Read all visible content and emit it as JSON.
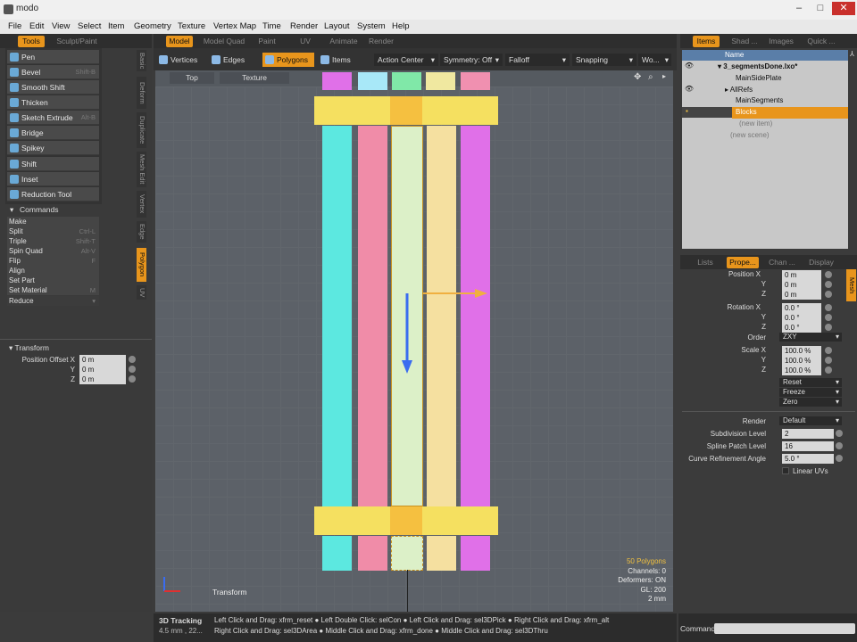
{
  "app": {
    "title": "modo"
  },
  "menu": [
    "File",
    "Edit",
    "View",
    "Select",
    "Item",
    "Geometry",
    "Texture",
    "Vertex Map",
    "Time",
    "Render",
    "Layout",
    "System",
    "Help"
  ],
  "left_tabs": {
    "tools": "Tools",
    "sculpt": "Sculpt/Paint"
  },
  "center_tabs": [
    "Model",
    "Model Quad",
    "Paint",
    "UV",
    "Animate",
    "Render"
  ],
  "right_tabs": [
    "Items",
    "Shad ...",
    "Images",
    "Quick ..."
  ],
  "tools": [
    {
      "label": "Pen",
      "shortcut": ""
    },
    {
      "label": "Bevel",
      "shortcut": "Shift-B"
    },
    {
      "label": "Smooth Shift",
      "shortcut": ""
    },
    {
      "label": "Thicken",
      "shortcut": ""
    },
    {
      "label": "Sketch Extrude",
      "shortcut": "Alt-B"
    },
    {
      "label": "Bridge",
      "shortcut": ""
    },
    {
      "label": "Spikey",
      "shortcut": ""
    },
    {
      "label": "Shift",
      "shortcut": ""
    },
    {
      "label": "Inset",
      "shortcut": ""
    },
    {
      "label": "Reduction Tool",
      "shortcut": ""
    }
  ],
  "commands_header": "Commands",
  "commands": [
    {
      "label": "Make",
      "shortcut": ""
    },
    {
      "label": "Split",
      "shortcut": "Ctrl-L"
    },
    {
      "label": "Triple",
      "shortcut": "Shift-T"
    },
    {
      "label": "Spin Quad",
      "shortcut": "Alt-V"
    },
    {
      "label": "Flip",
      "shortcut": "F"
    },
    {
      "label": "Align",
      "shortcut": ""
    },
    {
      "label": "Set Part",
      "shortcut": ""
    },
    {
      "label": "Set Material",
      "shortcut": "M"
    },
    {
      "label": "Reduce",
      "shortcut": ""
    }
  ],
  "side_vtabs": [
    "Basic",
    "Deform",
    "Duplicate",
    "Mesh Edit",
    "Vertex",
    "Edge",
    "Polygon",
    "UV"
  ],
  "transform_panel": {
    "header": "Transform",
    "pos_label": "Position Offset X",
    "y": "Y",
    "z": "Z",
    "x_val": "0 m",
    "y_val": "0 m",
    "z_val": "0 m"
  },
  "mode_bar": {
    "vertices": "Vertices",
    "edges": "Edges",
    "polygons": "Polygons",
    "items": "Items",
    "action_center": "Action Center",
    "symmetry": "Symmetry: Off",
    "falloff": "Falloff",
    "snapping": "Snapping",
    "wo": "Wo..."
  },
  "viewport": {
    "view": "Top",
    "shading": "Texture",
    "overlay": "Transform",
    "stats": [
      "50 Polygons",
      "Channels: 0",
      "Deformers: ON",
      "GL: 200",
      "2 mm"
    ]
  },
  "scene_tree": {
    "header": "Name",
    "scene": "3_segmentsDone.lxo*",
    "items": [
      "MainSidePlate",
      "AllRefs",
      "MainSegments",
      "Blocks",
      "(new item)",
      "(new scene)"
    ]
  },
  "props_tabs": [
    "Lists",
    "Prope...",
    "Chan ...",
    "Display"
  ],
  "props": {
    "position_label": "Position X",
    "px": "0 m",
    "py": "0 m",
    "pz": "0 m",
    "rotation_label": "Rotation X",
    "rx": "0.0 °",
    "ry": "0.0 °",
    "rz": "0.0 °",
    "order_label": "Order",
    "order": "ZXY",
    "scale_label": "Scale X",
    "sx": "100.0 %",
    "sy": "100.0 %",
    "sz": "100.0 %",
    "reset": "Reset",
    "freeze": "Freeze",
    "zero": "Zero",
    "render_label": "Render",
    "render": "Default",
    "subdiv_label": "Subdivision Level",
    "subdiv": "2",
    "spline_label": "Spline Patch Level",
    "spline": "16",
    "curve_label": "Curve Refinement Angle",
    "curve": "5.0 °",
    "linear_uvs": "Linear UVs",
    "y": "Y",
    "z": "Z",
    "mesh_tab": "Mesh"
  },
  "statusbar": {
    "title": "3D Tracking",
    "coords": "4.5 mm , 22...",
    "line1": "Left Click and Drag: xfrm_reset ● Left Double Click: selCon ● Left Click and Drag: sel3DPick ● Right Click and Drag: xfrm_alt",
    "line2": "Right Click and Drag: sel3DArea ● Middle Click and Drag: xfrm_done ● Middle Click and Drag: sel3DThru",
    "command_label": "Command"
  },
  "colors": {
    "accent": "#e8951c",
    "cyan": "#5ce8e0",
    "pink": "#f08ca8",
    "green": "#c8f0c8",
    "yellow": "#f5e060",
    "magenta": "#e070e8"
  }
}
